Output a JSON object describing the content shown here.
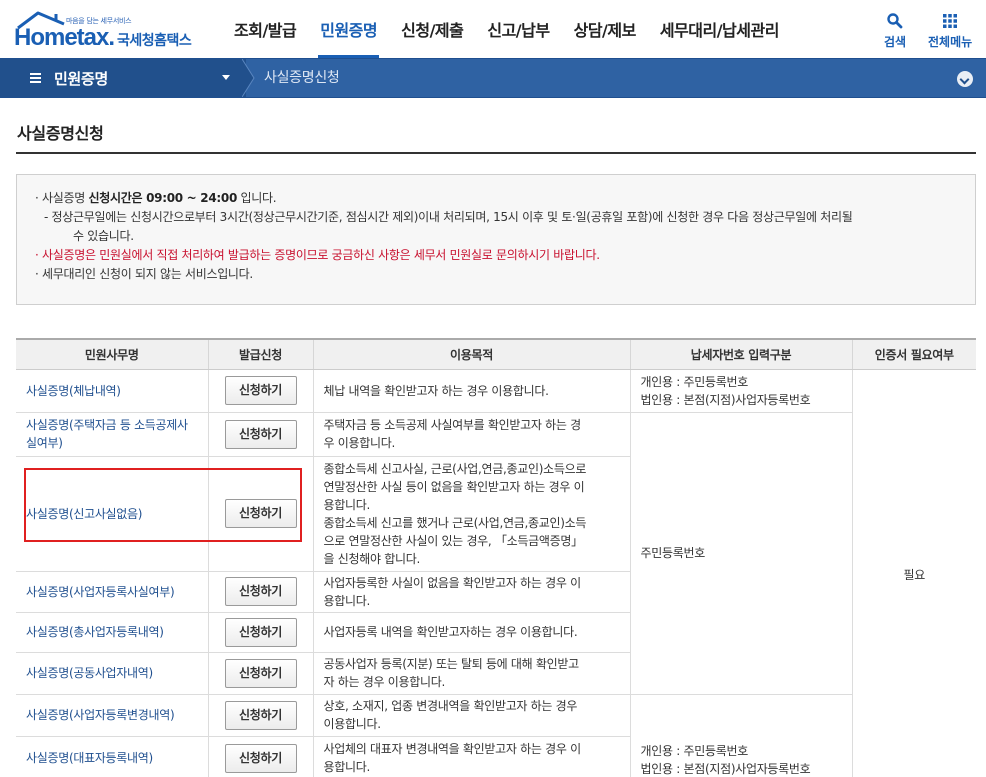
{
  "header": {
    "logo_tagline": "마음을 담는 세무서비스",
    "logo_text": "Hometax.",
    "logo_kor": "국세청홈택스",
    "nav": [
      {
        "label": "조회/발급"
      },
      {
        "label": "민원증명",
        "active": true
      },
      {
        "label": "신청/제출"
      },
      {
        "label": "신고/납부"
      },
      {
        "label": "상담/제보"
      },
      {
        "label": "세무대리/납세관리"
      }
    ],
    "search_label": "검색",
    "menu_label": "전체메뉴"
  },
  "navbar": {
    "section": "민원증명",
    "current": "사실증명신청"
  },
  "page_title": "사실증명신청",
  "notice": {
    "line1_pre": "사실증명 ",
    "line1_strong": "신청시간은 09:00 ~ 24:00",
    "line1_post": " 입니다.",
    "line2": "- 정상근무일에는 신청시간으로부터 3시간(정상근무시간기준, 점심시간 제외)이내 처리되며, 15시 이후 및 토·일(공휴일 포함)에 신청한 경우 다음 정상근무일에 처리될",
    "line2b": "수 있습니다.",
    "line3": "사실증명은 민원실에서 직접 처리하여 발급하는 증명이므로 궁금하신 사항은 세무서 민원실로 문의하시기 바랍니다.",
    "line4": "세무대리인 신청이 되지 않는 서비스입니다."
  },
  "table": {
    "headers": [
      "민원사무명",
      "발급신청",
      "이용목적",
      "납세자번호 입력구분",
      "인증서 필요여부"
    ],
    "apply_label": "신청하기",
    "rows": [
      {
        "name": "사실증명(체납내역)",
        "purpose": [
          "체납 내역을 확인받고자 하는 경우 이용합니다."
        ]
      },
      {
        "name": "사실증명(주택자금 등 소득공제사실여부)",
        "purpose": [
          "주택자금 등 소득공제 사실여부를 확인받고자 하는 경",
          "우 이용합니다."
        ]
      },
      {
        "name": "사실증명(신고사실없음)",
        "purpose": [
          "종합소득세 신고사실, 근로(사업,연금,종교인)소득으로",
          "연말정산한 사실 등이 없음을 확인받고자 하는 경우 이",
          "용합니다.",
          "종합소득세 신고를 했거나 근로(사업,연금,종교인)소득",
          "으로 연말정산한 사실이 있는 경우, 「소득금액증명」",
          "을 신청해야 합니다."
        ]
      },
      {
        "name": "사실증명(사업자등록사실여부)",
        "purpose": [
          "사업자등록한 사실이 없음을 확인받고자 하는 경우 이",
          "용합니다."
        ]
      },
      {
        "name": "사실증명(총사업자등록내역)",
        "purpose": [
          "사업자등록 내역을 확인받고자하는 경우 이용합니다."
        ]
      },
      {
        "name": "사실증명(공동사업자내역)",
        "purpose": [
          "공동사업자 등록(지분) 또는 탈퇴 등에 대해 확인받고",
          "자 하는 경우 이용합니다."
        ]
      },
      {
        "name": "사실증명(사업자등록변경내역)",
        "purpose": [
          "상호, 소재지, 업종 변경내역을 확인받고자 하는 경우",
          "이용합니다."
        ]
      },
      {
        "name": "사실증명(대표자등록내역)",
        "purpose": [
          "사업체의 대표자 변경내역을 확인받고자 하는 경우 이",
          "용합니다."
        ]
      }
    ],
    "type_group1": [
      "개인용 : 주민등록번호",
      "법인용 : 본점(지점)사업자등록번호"
    ],
    "type_group2": "주민등록번호",
    "type_group3": [
      "개인용 : 주민등록번호",
      "법인용 : 본점(지점)사업자등록번호"
    ],
    "cert_required": "필요"
  },
  "colors": {
    "brand": "#1a5fb4",
    "navbar": "#2f62a3",
    "notice_red": "#c8102e",
    "highlight": "#e02020"
  }
}
